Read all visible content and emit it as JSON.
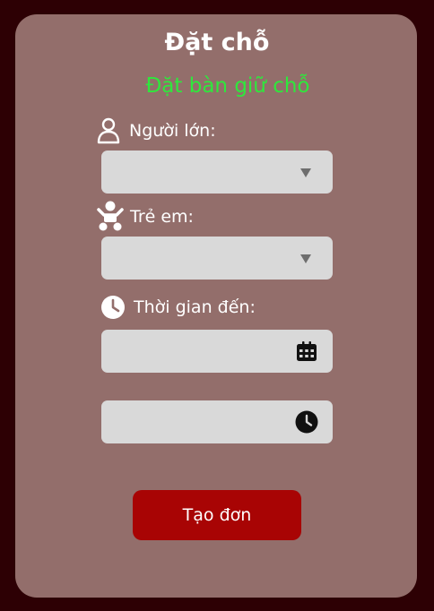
{
  "page": {
    "title": "Đặt chỗ",
    "subtitle": "Đặt bàn giữ chỗ"
  },
  "form": {
    "adults": {
      "label": "Người lớn:",
      "icon": "person-icon",
      "value": ""
    },
    "children": {
      "label": "Trẻ em:",
      "icon": "baby-icon",
      "value": ""
    },
    "arrival": {
      "label": "Thời gian đến:",
      "icon": "clock-icon"
    },
    "date": {
      "value": "",
      "icon": "calendar-icon"
    },
    "time": {
      "value": "",
      "icon": "clock-icon"
    },
    "submit_label": "Tạo đơn"
  },
  "colors": {
    "page_background": "#2d0004",
    "card_background": "#936e6b",
    "subtitle": "#2ee83c",
    "submit_button": "#a80404",
    "field_background": "#d9d9d9"
  }
}
